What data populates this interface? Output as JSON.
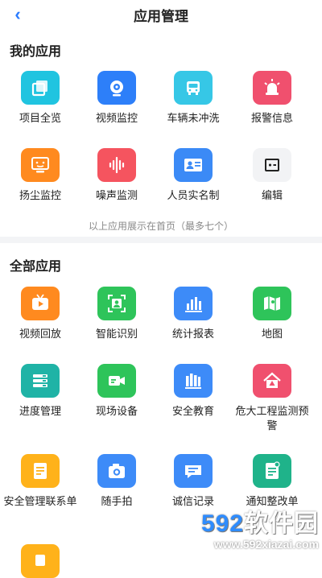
{
  "header": {
    "title": "应用管理"
  },
  "my_apps": {
    "title": "我的应用",
    "hint": "以上应用展示在首页（最多七个）",
    "items": [
      {
        "label": "项目全览",
        "icon": "window-stack-icon",
        "color": "#20c4e0"
      },
      {
        "label": "视频监控",
        "icon": "camera-lens-icon",
        "color": "#2d7ff9"
      },
      {
        "label": "车辆未冲洗",
        "icon": "truck-icon",
        "color": "#36c7e6"
      },
      {
        "label": "报警信息",
        "icon": "siren-icon",
        "color": "#f0506e"
      },
      {
        "label": "扬尘监控",
        "icon": "monitor-icon",
        "color": "#ff8a1f"
      },
      {
        "label": "噪声监测",
        "icon": "sound-wave-icon",
        "color": "#f5545f"
      },
      {
        "label": "人员实名制",
        "icon": "id-card-icon",
        "color": "#3b8af6"
      },
      {
        "label": "编辑",
        "icon": "plus-minus-icon",
        "color": "#f2f3f5"
      }
    ]
  },
  "all_apps": {
    "title": "全部应用",
    "items": [
      {
        "label": "视频回放",
        "icon": "play-tv-icon",
        "color": "#ff8a1f"
      },
      {
        "label": "智能识别",
        "icon": "face-scan-icon",
        "color": "#2ec45a"
      },
      {
        "label": "统计报表",
        "icon": "bar-chart-icon",
        "color": "#3d8bf8"
      },
      {
        "label": "地图",
        "icon": "map-icon",
        "color": "#2ec45a"
      },
      {
        "label": "进度管理",
        "icon": "list-bars-icon",
        "color": "#1fb3a6"
      },
      {
        "label": "现场设备",
        "icon": "video-camera-icon",
        "color": "#2ec45a"
      },
      {
        "label": "安全教育",
        "icon": "books-icon",
        "color": "#3d8bf8"
      },
      {
        "label": "危大工程监测预警",
        "icon": "house-alert-icon",
        "color": "#f0506e"
      },
      {
        "label": "安全管理联系单",
        "icon": "document-icon",
        "color": "#ffb21a"
      },
      {
        "label": "随手拍",
        "icon": "photo-camera-icon",
        "color": "#3d8bf8"
      },
      {
        "label": "诚信记录",
        "icon": "chat-heart-icon",
        "color": "#3d8bf8"
      },
      {
        "label": "通知整改单",
        "icon": "notice-doc-icon",
        "color": "#1fb38a"
      },
      {
        "label": "",
        "icon": "app-icon",
        "color": "#ffb21a"
      }
    ]
  },
  "watermark": {
    "digits": "592",
    "text": "软件园",
    "url": "www.592xiazai.com"
  }
}
